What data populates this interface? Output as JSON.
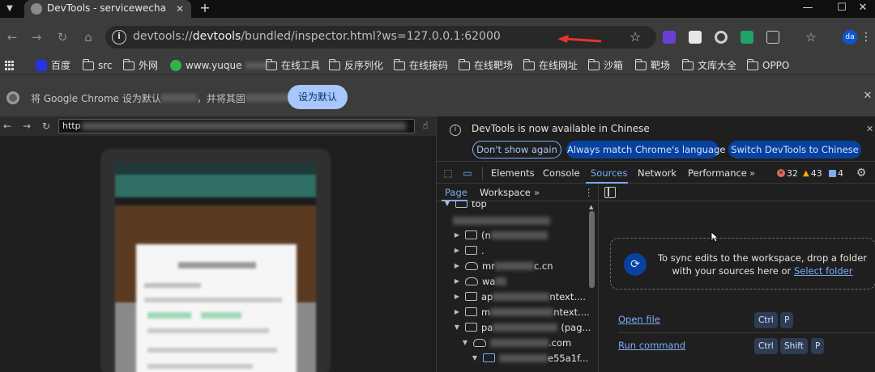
{
  "browser": {
    "tab_title": "DevTools - servicewechat.com",
    "new_tab": "+",
    "url_prefix": "devtools://",
    "url_host": "devtools",
    "url_rest": "/bundled/inspector.html?ws=127.0.0.1:62000",
    "profile_initials": "da"
  },
  "bookmarks": [
    {
      "label": "百度",
      "icon": "baidu-icon"
    },
    {
      "label": "src",
      "icon": "folder-icon"
    },
    {
      "label": "外网",
      "icon": "folder-icon"
    },
    {
      "label": "www.yuque",
      "icon": "yuque-icon"
    },
    {
      "label": "在线工具",
      "icon": "folder-icon"
    },
    {
      "label": "反序列化",
      "icon": "folder-icon"
    },
    {
      "label": "在线接码",
      "icon": "folder-icon"
    },
    {
      "label": "在线靶场",
      "icon": "folder-icon"
    },
    {
      "label": "在线网址",
      "icon": "folder-icon"
    },
    {
      "label": "沙箱",
      "icon": "folder-icon"
    },
    {
      "label": "靶场",
      "icon": "folder-icon"
    },
    {
      "label": "文库大全",
      "icon": "folder-icon"
    },
    {
      "label": "OPPO",
      "icon": "folder-icon"
    }
  ],
  "infobar": {
    "text_part1": "将 Google Chrome 设为默认",
    "text_part2": "，并将其固",
    "text_part3": "栏",
    "button": "设为默认"
  },
  "inspected_page": {
    "url_visible": "http"
  },
  "devtools": {
    "banner": {
      "message": "DevTools is now available in Chinese",
      "dont_show": "Don't show again",
      "always_match": "Always match Chrome's language",
      "switch": "Switch DevTools to Chinese"
    },
    "tabs": [
      "Elements",
      "Console",
      "Sources",
      "Network",
      "Performance"
    ],
    "more_tabs": "»",
    "errors": "32",
    "warnings": "43",
    "info": "4",
    "sources": {
      "subtabs": [
        "Page",
        "Workspace"
      ],
      "more": "»",
      "tree": [
        {
          "arrow": "▼",
          "icon": "frame",
          "text": "top",
          "indent": 0
        },
        {
          "arrow": "",
          "icon": "none",
          "text": "",
          "indent": 1
        },
        {
          "arrow": "▶",
          "icon": "frame",
          "text": "(n",
          "indent": 1
        },
        {
          "arrow": "▶",
          "icon": "frame",
          "text": ".",
          "indent": 1
        },
        {
          "arrow": "▶",
          "icon": "cloud",
          "text": "mr",
          "suffix": "c.cn",
          "indent": 1
        },
        {
          "arrow": "▶",
          "icon": "cloud",
          "text": "wa",
          "indent": 1
        },
        {
          "arrow": "▶",
          "icon": "frame",
          "text": "ap",
          "suffix": "ntext....",
          "indent": 1
        },
        {
          "arrow": "▶",
          "icon": "frame",
          "text": "m",
          "suffix": "ntext....",
          "indent": 1
        },
        {
          "arrow": "▼",
          "icon": "frame",
          "text": "pa",
          "suffix": "(pag...",
          "indent": 1
        },
        {
          "arrow": "▼",
          "icon": "cloud",
          "text": "",
          "suffix": ".com",
          "indent": 2
        },
        {
          "arrow": "▼",
          "icon": "frame",
          "text": "",
          "suffix": "e55a1f...",
          "indent": 3
        }
      ]
    },
    "workspace": {
      "drop_text": "To sync edits to the workspace, drop a folder with your sources here or",
      "drop_link": "Select folder"
    },
    "shortcuts": [
      {
        "label": "Open file",
        "keys": [
          "Ctrl",
          "P"
        ]
      },
      {
        "label": "Run command",
        "keys": [
          "Ctrl",
          "Shift",
          "P"
        ]
      }
    ]
  },
  "colors": {
    "accent": "#7cacf8",
    "error": "#e46962",
    "warning": "#f9ab00",
    "info": "#7cacf8",
    "annotation_arrow": "#e5342a"
  }
}
